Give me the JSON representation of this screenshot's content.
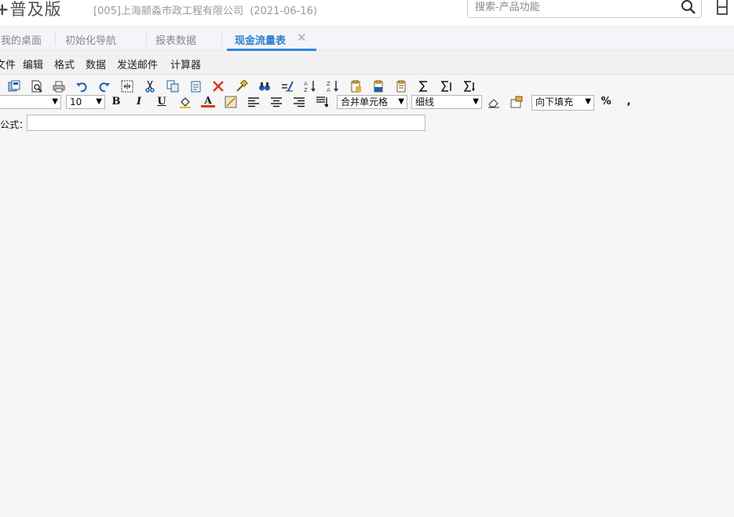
{
  "header": {
    "logo_text": "普及版",
    "logo_plus": "+",
    "company": "[005]上海颛淼市政工程有限公司",
    "date": "(2021-06-16)",
    "search_placeholder": "搜索-产品功能"
  },
  "tabs": [
    {
      "label": "我的桌面"
    },
    {
      "label": "初始化导航"
    },
    {
      "label": "报表数据"
    },
    {
      "label": "现金流量表",
      "active": true,
      "close": "✕"
    }
  ],
  "menu": [
    "文件",
    "编辑",
    "格式",
    "数据",
    "发送邮件",
    "计算器"
  ],
  "toolbar2": {
    "font_name": "",
    "font_size": "10",
    "bold": "B",
    "italic": "I",
    "underline": "U",
    "font_color": "A",
    "merge_cells": "合并单元格",
    "border_style": "细线",
    "fill_direction": "向下填充",
    "percent": "%",
    "comma": ","
  },
  "formula": {
    "label": "公式：",
    "value": ""
  },
  "colors": {
    "accent": "#2f86d9",
    "delete": "#d23a1a"
  }
}
